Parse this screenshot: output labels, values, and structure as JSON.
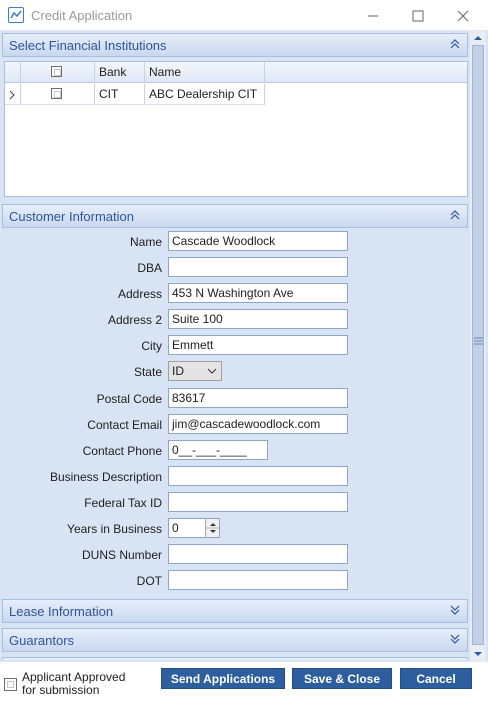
{
  "window": {
    "title": "Credit Application",
    "controls": {
      "minimize_icon": "minimize-icon",
      "maximize_icon": "maximize-icon",
      "close_icon": "close-icon"
    }
  },
  "institutions": {
    "header": "Select Financial Institutions",
    "columns": {
      "bank": "Bank",
      "name": "Name"
    },
    "rows": [
      {
        "bank": "CIT",
        "name": "ABC Dealership CIT",
        "checked": false
      }
    ]
  },
  "customer": {
    "header": "Customer Information",
    "labels": {
      "name": "Name",
      "dba": "DBA",
      "address": "Address",
      "address2": "Address 2",
      "city": "City",
      "state": "State",
      "postal_code": "Postal Code",
      "contact_email": "Contact Email",
      "contact_phone": "Contact Phone",
      "business_description": "Business Description",
      "federal_tax_id": "Federal Tax ID",
      "years_in_business": "Years in Business",
      "duns_number": "DUNS Number",
      "dot": "DOT"
    },
    "values": {
      "name": "Cascade Woodlock",
      "dba": "",
      "address": "453 N Washington Ave",
      "address2": "Suite 100",
      "city": "Emmett",
      "state": "ID",
      "postal_code": "83617",
      "contact_email": "jim@cascadewoodlock.com",
      "contact_phone": "0__-___-____",
      "business_description": "",
      "federal_tax_id": "",
      "years_in_business": "0",
      "duns_number": "",
      "dot": ""
    }
  },
  "lease": {
    "header": "Lease Information"
  },
  "guarantors": {
    "header": "Guarantors"
  },
  "footer": {
    "approved_label": "Applicant Approved for submission",
    "approved_checked": false,
    "send_label": "Send Applications",
    "save_label": "Save & Close",
    "cancel_label": "Cancel"
  },
  "colors": {
    "accent": "#2d5f9e",
    "section_text": "#2f5597",
    "panel_bg": "#d8e3f3"
  }
}
